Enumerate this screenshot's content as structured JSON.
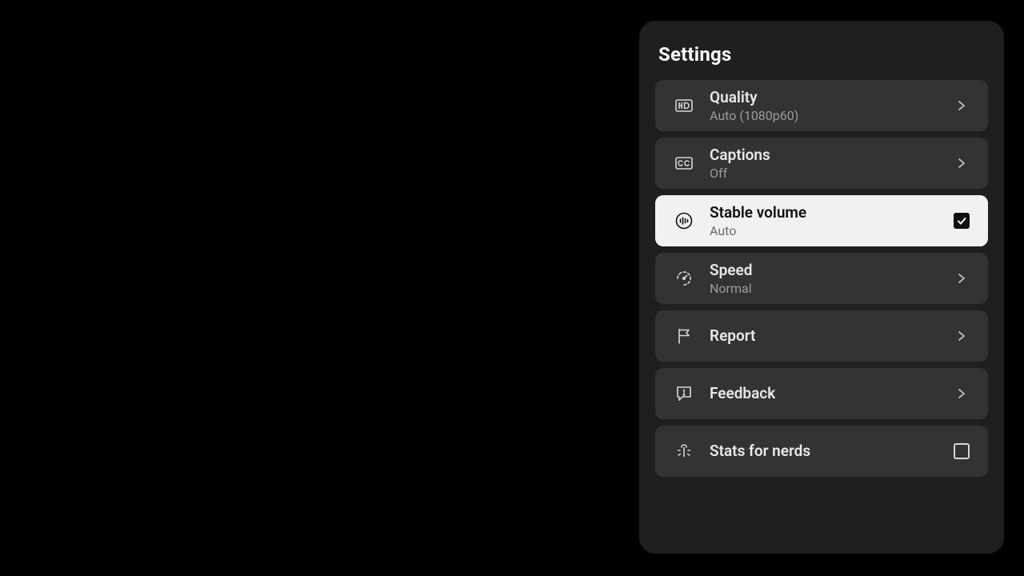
{
  "panel": {
    "title": "Settings",
    "items": [
      {
        "id": "quality",
        "label": "Quality",
        "sub": "Auto (1080p60)",
        "trailing": "chevron",
        "selected": false
      },
      {
        "id": "captions",
        "label": "Captions",
        "sub": "Off",
        "trailing": "chevron",
        "selected": false
      },
      {
        "id": "stable-volume",
        "label": "Stable volume",
        "sub": "Auto",
        "trailing": "checkbox-checked",
        "selected": true
      },
      {
        "id": "speed",
        "label": "Speed",
        "sub": "Normal",
        "trailing": "chevron",
        "selected": false
      },
      {
        "id": "report",
        "label": "Report",
        "sub": null,
        "trailing": "chevron",
        "selected": false
      },
      {
        "id": "feedback",
        "label": "Feedback",
        "sub": null,
        "trailing": "chevron",
        "selected": false
      },
      {
        "id": "stats",
        "label": "Stats for nerds",
        "sub": null,
        "trailing": "checkbox-unchecked",
        "selected": false
      }
    ]
  }
}
